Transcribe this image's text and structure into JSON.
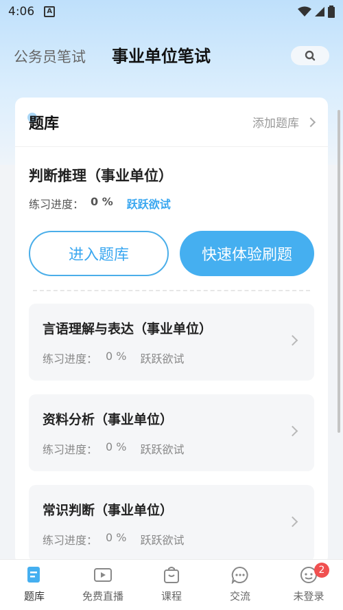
{
  "status_bar": {
    "time": "4:06",
    "app_icon": "A"
  },
  "tabs": [
    {
      "label": "公务员笔试",
      "active": false
    },
    {
      "label": "事业单位笔试",
      "active": true
    }
  ],
  "card": {
    "title": "题库",
    "add_label": "添加题库",
    "featured": {
      "title": "判断推理（事业单位）",
      "progress_label": "练习进度：",
      "progress_value": "0 %",
      "status": "跃跃欲试",
      "enter_button": "进入题库",
      "quick_button": "快速体验刷题"
    },
    "items": [
      {
        "title": "言语理解与表达（事业单位）",
        "progress_label": "练习进度：",
        "progress_value": "0 %",
        "status": "跃跃欲试"
      },
      {
        "title": "资料分析（事业单位）",
        "progress_label": "练习进度：",
        "progress_value": "0 %",
        "status": "跃跃欲试"
      },
      {
        "title": "常识判断（事业单位）",
        "progress_label": "练习进度：",
        "progress_value": "0 %",
        "status": "跃跃欲试"
      }
    ]
  },
  "bottom_nav": [
    {
      "label": "题库",
      "icon": "question-bank-icon",
      "active": true
    },
    {
      "label": "免费直播",
      "icon": "live-video-icon"
    },
    {
      "label": "课程",
      "icon": "course-bag-icon"
    },
    {
      "label": "交流",
      "icon": "chat-bubble-icon"
    },
    {
      "label": "未登录",
      "icon": "user-avatar-icon",
      "badge": "2"
    }
  ],
  "colors": {
    "accent": "#45aff0",
    "badge": "#f05050"
  }
}
